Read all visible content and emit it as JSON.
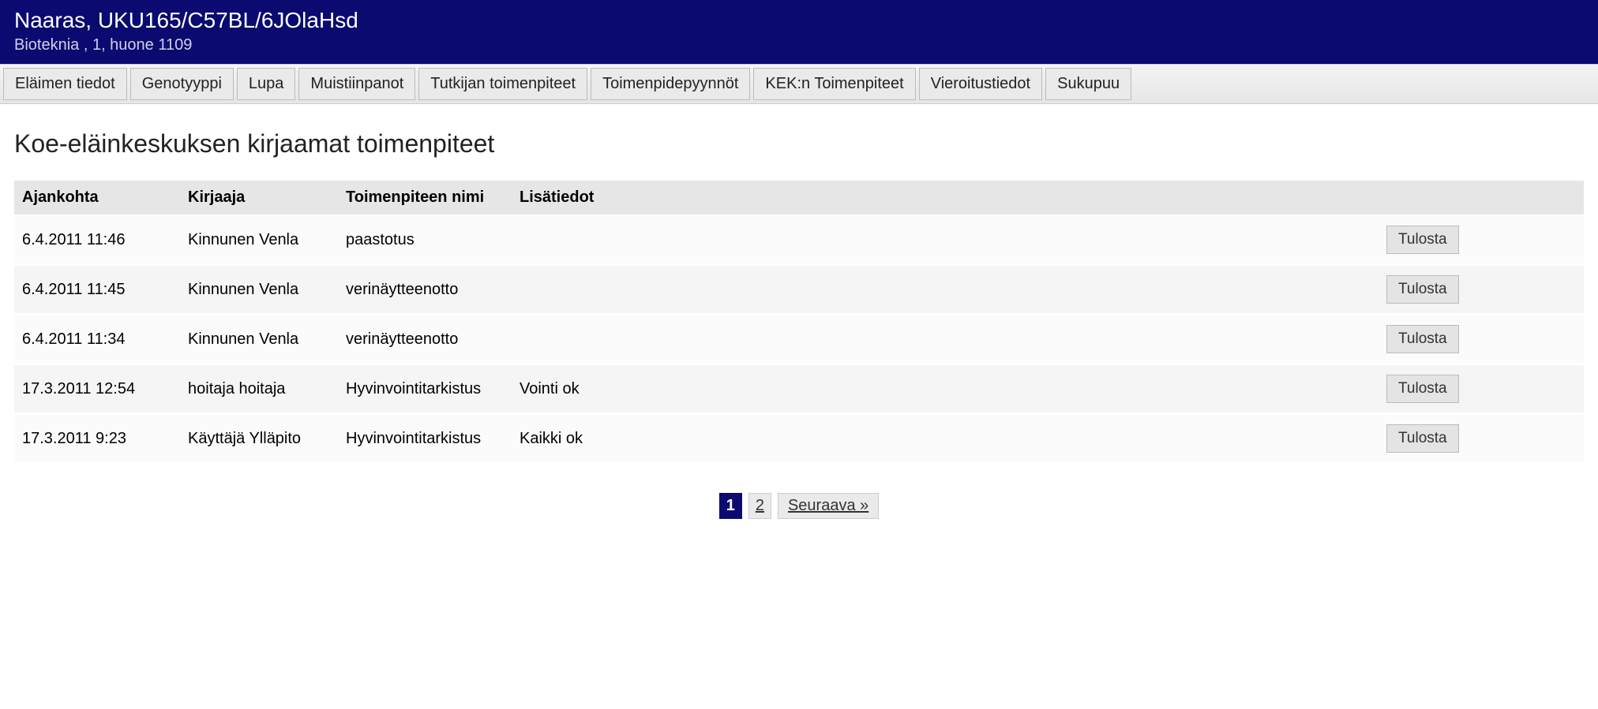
{
  "header": {
    "title": "Naaras, UKU165/C57BL/6JOlaHsd",
    "subtitle": "Bioteknia , 1, huone 1109"
  },
  "tabs": [
    "Eläimen tiedot",
    "Genotyyppi",
    "Lupa",
    "Muistiinpanot",
    "Tutkijan toimenpiteet",
    "Toimenpidepyynnöt",
    "KEK:n Toimenpiteet",
    "Vieroitustiedot",
    "Sukupuu"
  ],
  "main": {
    "title": "Koe-eläinkeskuksen kirjaamat toimenpiteet",
    "columns": {
      "time": "Ajankohta",
      "author": "Kirjaaja",
      "name": "Toimenpiteen nimi",
      "info": "Lisätiedot",
      "action": ""
    },
    "print_label": "Tulosta",
    "rows": [
      {
        "time": "6.4.2011 11:46",
        "author": "Kinnunen Venla",
        "name": "paastotus",
        "info": ""
      },
      {
        "time": "6.4.2011 11:45",
        "author": "Kinnunen Venla",
        "name": "verinäytteenotto",
        "info": ""
      },
      {
        "time": "6.4.2011 11:34",
        "author": "Kinnunen Venla",
        "name": "verinäytteenotto",
        "info": ""
      },
      {
        "time": "17.3.2011 12:54",
        "author": "hoitaja hoitaja",
        "name": "Hyvinvointitarkistus",
        "info": "Vointi ok"
      },
      {
        "time": "17.3.2011 9:23",
        "author": "Käyttäjä Ylläpito",
        "name": "Hyvinvointitarkistus",
        "info": "Kaikki ok"
      }
    ]
  },
  "pager": {
    "pages": [
      "1",
      "2"
    ],
    "active_index": 0,
    "next_label": "Seuraava »"
  }
}
